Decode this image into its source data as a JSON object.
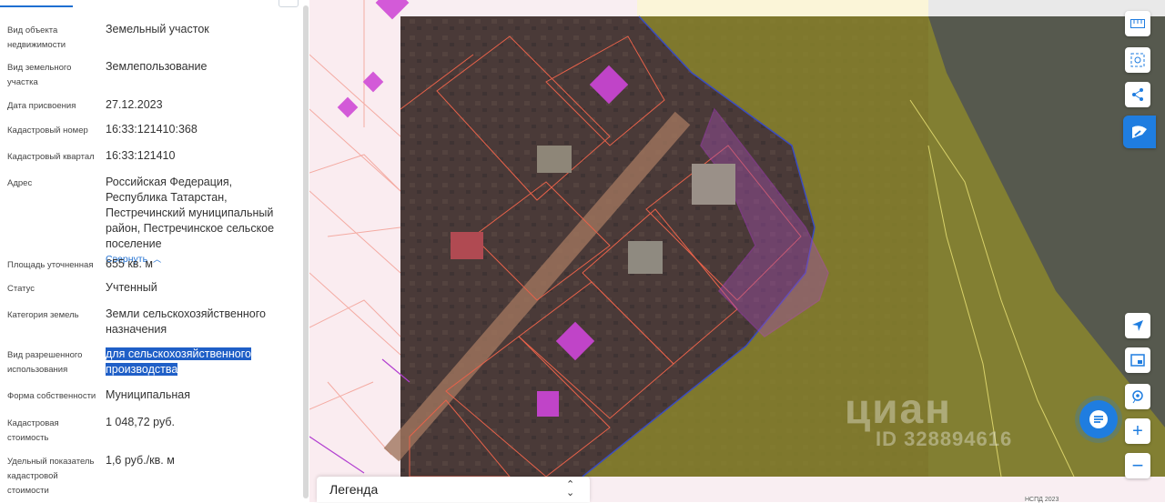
{
  "fields": [
    {
      "label": "Вид объекта недвижимости",
      "value": "Земельный участок"
    },
    {
      "label": "Вид земельного участка",
      "value": "Землепользование"
    },
    {
      "label": "Дата присвоения",
      "value": "27.12.2023"
    },
    {
      "label": "Кадастровый номер",
      "value": "16:33:121410:368"
    },
    {
      "label": "Кадастровый квартал",
      "value": "16:33:121410"
    },
    {
      "label": "Адрес",
      "value": "Российская Федерация, Республика Татарстан, Пестречинский муниципальный район, Пестречинское сельское поселение"
    },
    {
      "label": "Площадь уточненная",
      "value": "655 кв. м"
    },
    {
      "label": "Статус",
      "value": "Учтенный"
    },
    {
      "label": "Категория земель",
      "value": "Земли сельскохозяйственного назначения"
    },
    {
      "label": "Вид разрешенного использования",
      "value": "для сельскохозяйственного производства"
    },
    {
      "label": "Форма собственности",
      "value": "Муниципальная"
    },
    {
      "label": "Кадастровая стоимость",
      "value": "1 048,72 руб."
    },
    {
      "label": "Удельный показатель кадастровой стоимости",
      "value": "1,6 руб./кв. м"
    }
  ],
  "address_collapse_label": "Свернуть",
  "legend_title": "Легенда",
  "watermark": {
    "brand": "циан",
    "id": "ID 328894616"
  },
  "copyright": "НСПД 2023",
  "colors": {
    "accent": "#1f7de0",
    "parcel_border": "#e8624a",
    "zone_purple": "#b23fd0",
    "zone_yellow": "#c9c24a"
  },
  "icons": [
    "ruler-icon",
    "area-select-icon",
    "share-icon",
    "logo-icon",
    "locate-icon",
    "layers-icon",
    "pin-settings-icon",
    "zoom-in-icon",
    "zoom-out-icon",
    "chat-icon"
  ]
}
